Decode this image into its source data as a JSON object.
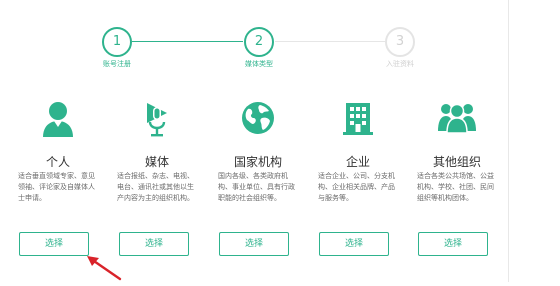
{
  "accent_color": "#2eb38d",
  "arrow_color": "#d9232a",
  "steps": [
    {
      "number": "1",
      "label": "账号注册",
      "state": "done"
    },
    {
      "number": "2",
      "label": "媒体类型",
      "state": "active"
    },
    {
      "number": "3",
      "label": "入驻资料",
      "state": "pending"
    }
  ],
  "media_types": [
    {
      "icon": "person-icon",
      "title": "个人",
      "description": "适合垂直领域专家、意见领袖、评论家及自媒体人士申请。",
      "button": "选择"
    },
    {
      "icon": "microphone-play-icon",
      "title": "媒体",
      "description": "适合报纸、杂志、电视、电台、通讯社或其他以生产内容为主的组织机构。",
      "button": "选择"
    },
    {
      "icon": "globe-icon",
      "title": "国家机构",
      "description": "国内各级、各类政府机构、事业单位、具有行政职能的社会组织等。",
      "button": "选择"
    },
    {
      "icon": "building-icon",
      "title": "企业",
      "description": "适合企业、公司、分支机构、企业相关品牌、产品与服务等。",
      "button": "选择"
    },
    {
      "icon": "group-icon",
      "title": "其他组织",
      "description": "适合各类公共场馆、公益机构、学校、社团、民间组织等机构团体。",
      "button": "选择"
    }
  ]
}
